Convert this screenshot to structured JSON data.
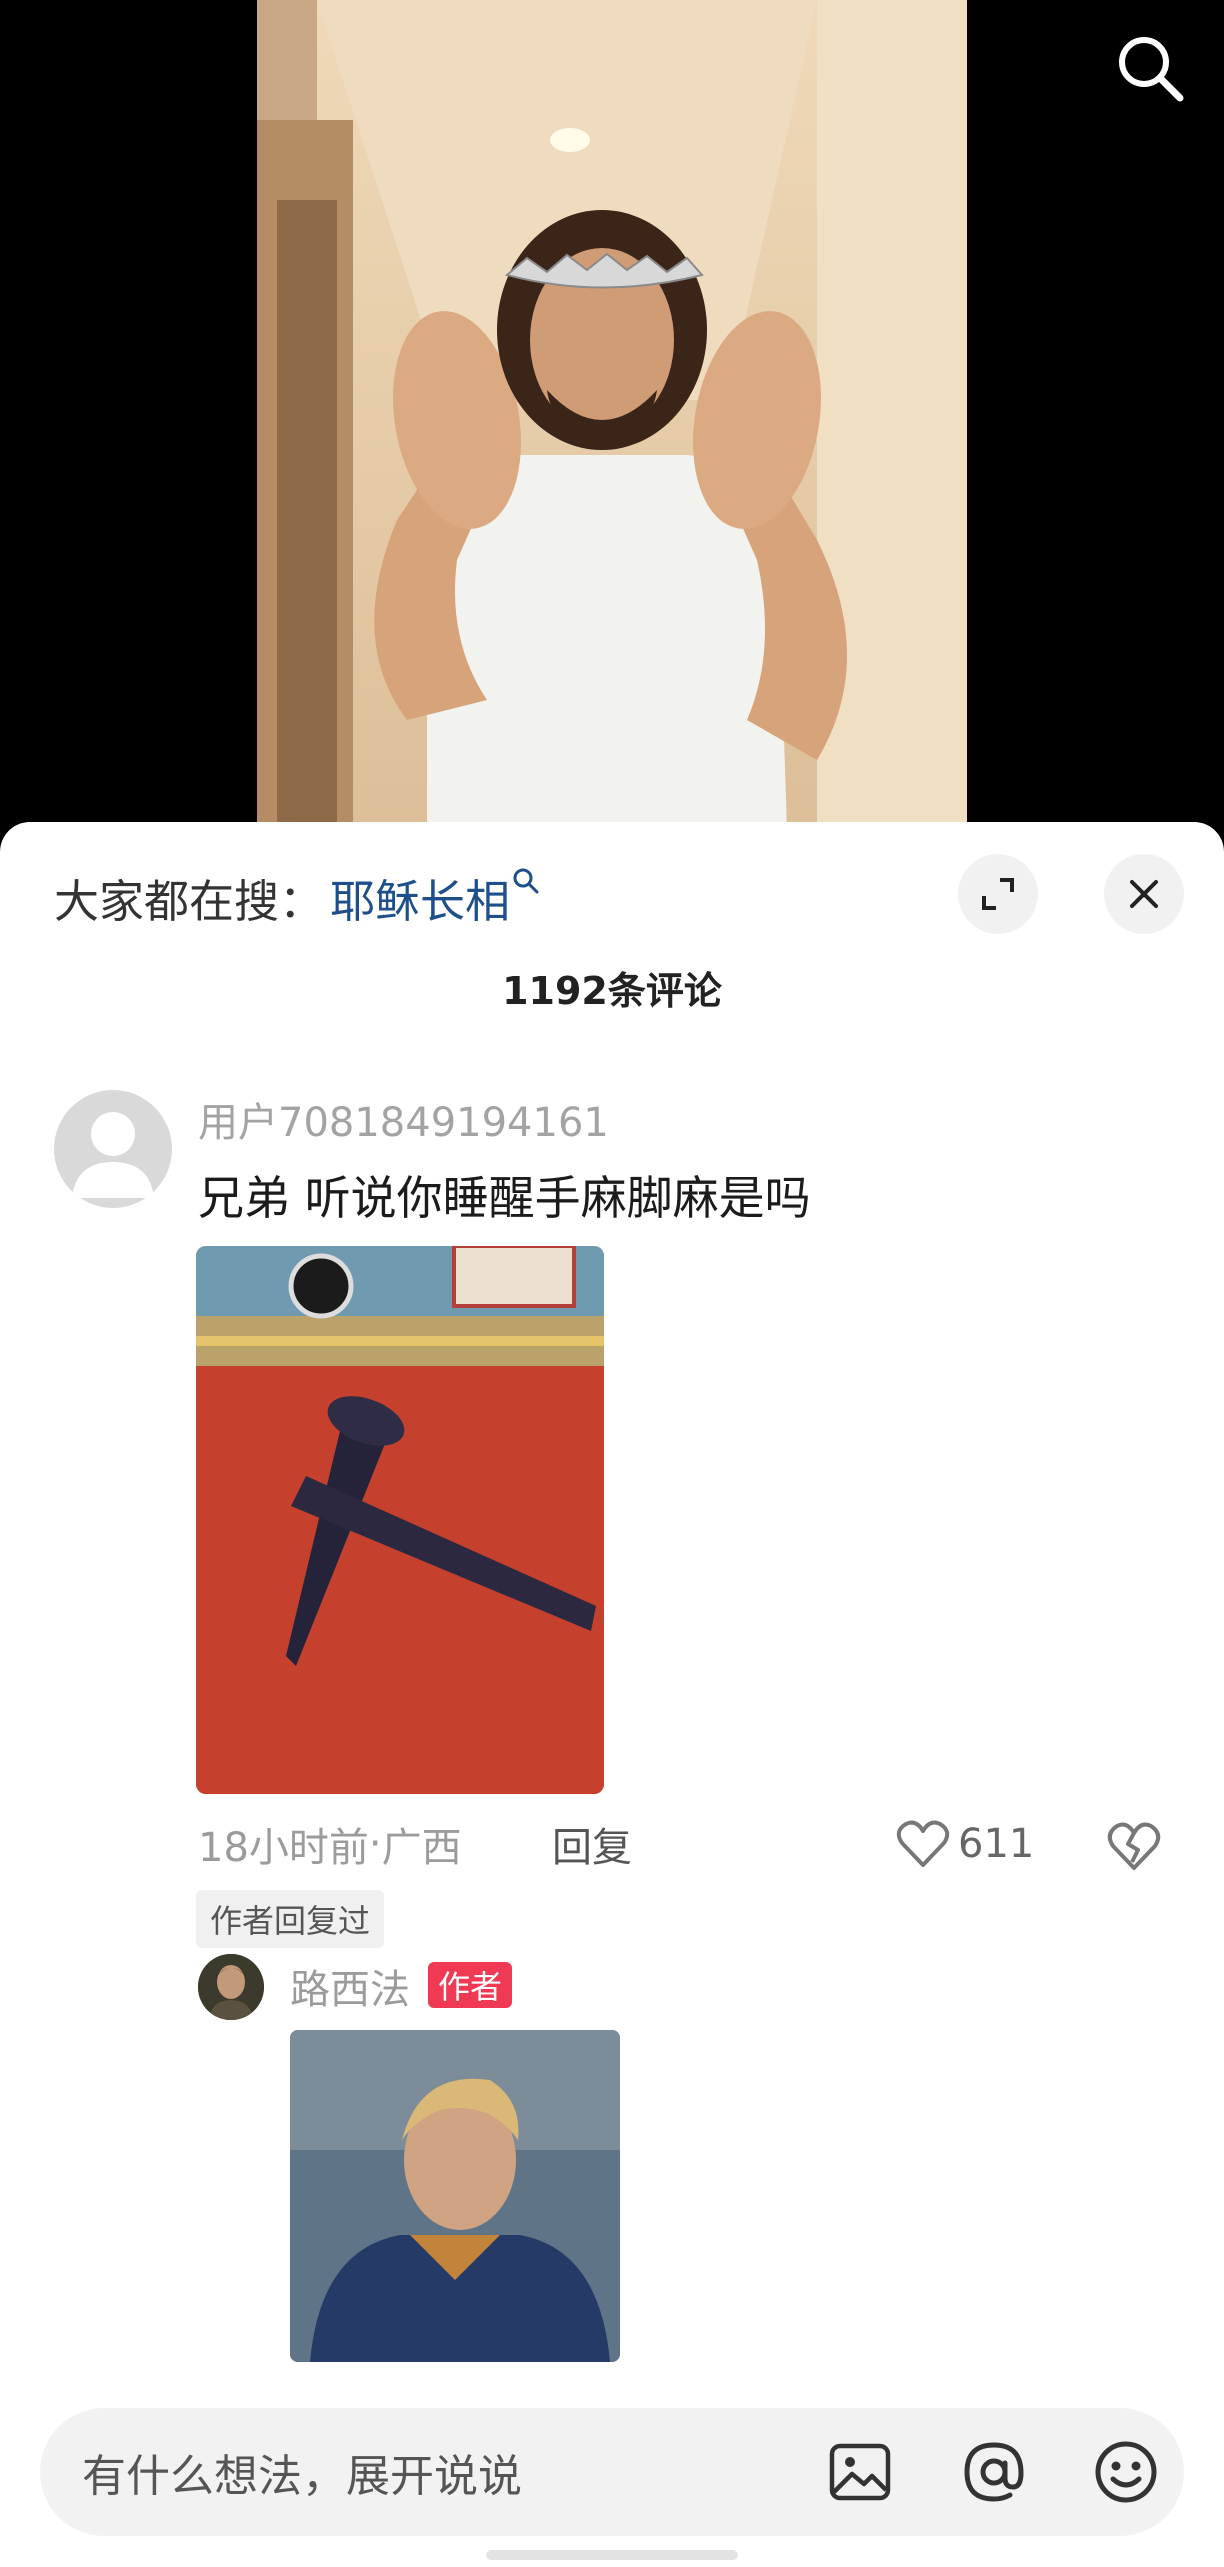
{
  "hot_search": {
    "prefix": "大家都在搜：",
    "term": "耶稣长相"
  },
  "comments_header": {
    "count_label": "1192条评论"
  },
  "comment": {
    "username": "用户7081849194161",
    "text": "兄弟 听说你睡醒手麻脚麻是吗",
    "time": "18小时前",
    "location": "广西",
    "separator": " · ",
    "reply_label": "回复",
    "likes": "611",
    "author_replied_tag": "作者回复过"
  },
  "author_reply": {
    "name": "路西法",
    "badge": "作者"
  },
  "input": {
    "placeholder": "有什么想法，展开说说"
  },
  "icons": {
    "top_right": "search-icon",
    "expand": "expand-icon",
    "close": "close-icon",
    "like": "heart-icon",
    "dislike": "broken-heart-icon",
    "image": "image-icon",
    "mention": "at-icon",
    "emoji": "emoji-icon"
  },
  "colors": {
    "hot_term": "#1e4f8a",
    "author_badge": "#f03a54"
  }
}
